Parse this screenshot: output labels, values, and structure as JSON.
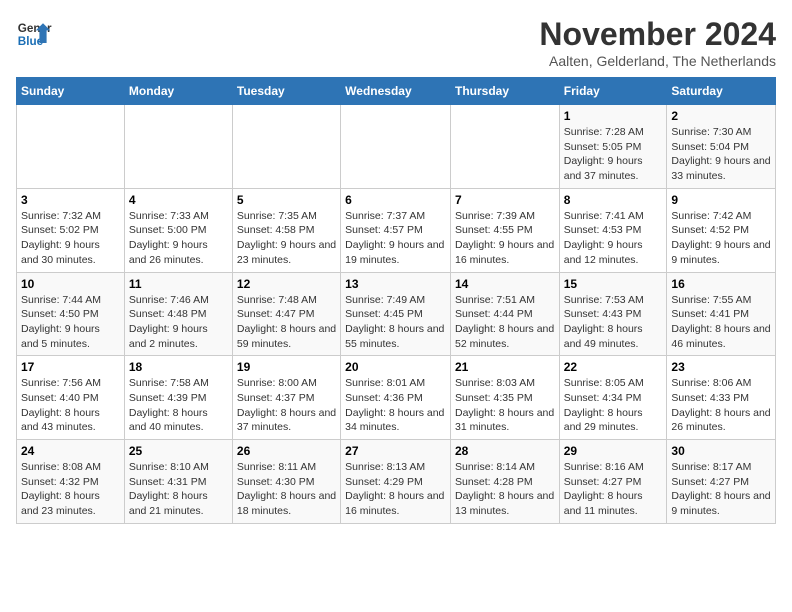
{
  "logo": {
    "line1": "General",
    "line2": "Blue"
  },
  "title": "November 2024",
  "subtitle": "Aalten, Gelderland, The Netherlands",
  "weekdays": [
    "Sunday",
    "Monday",
    "Tuesday",
    "Wednesday",
    "Thursday",
    "Friday",
    "Saturday"
  ],
  "weeks": [
    [
      {
        "day": "",
        "info": ""
      },
      {
        "day": "",
        "info": ""
      },
      {
        "day": "",
        "info": ""
      },
      {
        "day": "",
        "info": ""
      },
      {
        "day": "",
        "info": ""
      },
      {
        "day": "1",
        "info": "Sunrise: 7:28 AM\nSunset: 5:05 PM\nDaylight: 9 hours and 37 minutes."
      },
      {
        "day": "2",
        "info": "Sunrise: 7:30 AM\nSunset: 5:04 PM\nDaylight: 9 hours and 33 minutes."
      }
    ],
    [
      {
        "day": "3",
        "info": "Sunrise: 7:32 AM\nSunset: 5:02 PM\nDaylight: 9 hours and 30 minutes."
      },
      {
        "day": "4",
        "info": "Sunrise: 7:33 AM\nSunset: 5:00 PM\nDaylight: 9 hours and 26 minutes."
      },
      {
        "day": "5",
        "info": "Sunrise: 7:35 AM\nSunset: 4:58 PM\nDaylight: 9 hours and 23 minutes."
      },
      {
        "day": "6",
        "info": "Sunrise: 7:37 AM\nSunset: 4:57 PM\nDaylight: 9 hours and 19 minutes."
      },
      {
        "day": "7",
        "info": "Sunrise: 7:39 AM\nSunset: 4:55 PM\nDaylight: 9 hours and 16 minutes."
      },
      {
        "day": "8",
        "info": "Sunrise: 7:41 AM\nSunset: 4:53 PM\nDaylight: 9 hours and 12 minutes."
      },
      {
        "day": "9",
        "info": "Sunrise: 7:42 AM\nSunset: 4:52 PM\nDaylight: 9 hours and 9 minutes."
      }
    ],
    [
      {
        "day": "10",
        "info": "Sunrise: 7:44 AM\nSunset: 4:50 PM\nDaylight: 9 hours and 5 minutes."
      },
      {
        "day": "11",
        "info": "Sunrise: 7:46 AM\nSunset: 4:48 PM\nDaylight: 9 hours and 2 minutes."
      },
      {
        "day": "12",
        "info": "Sunrise: 7:48 AM\nSunset: 4:47 PM\nDaylight: 8 hours and 59 minutes."
      },
      {
        "day": "13",
        "info": "Sunrise: 7:49 AM\nSunset: 4:45 PM\nDaylight: 8 hours and 55 minutes."
      },
      {
        "day": "14",
        "info": "Sunrise: 7:51 AM\nSunset: 4:44 PM\nDaylight: 8 hours and 52 minutes."
      },
      {
        "day": "15",
        "info": "Sunrise: 7:53 AM\nSunset: 4:43 PM\nDaylight: 8 hours and 49 minutes."
      },
      {
        "day": "16",
        "info": "Sunrise: 7:55 AM\nSunset: 4:41 PM\nDaylight: 8 hours and 46 minutes."
      }
    ],
    [
      {
        "day": "17",
        "info": "Sunrise: 7:56 AM\nSunset: 4:40 PM\nDaylight: 8 hours and 43 minutes."
      },
      {
        "day": "18",
        "info": "Sunrise: 7:58 AM\nSunset: 4:39 PM\nDaylight: 8 hours and 40 minutes."
      },
      {
        "day": "19",
        "info": "Sunrise: 8:00 AM\nSunset: 4:37 PM\nDaylight: 8 hours and 37 minutes."
      },
      {
        "day": "20",
        "info": "Sunrise: 8:01 AM\nSunset: 4:36 PM\nDaylight: 8 hours and 34 minutes."
      },
      {
        "day": "21",
        "info": "Sunrise: 8:03 AM\nSunset: 4:35 PM\nDaylight: 8 hours and 31 minutes."
      },
      {
        "day": "22",
        "info": "Sunrise: 8:05 AM\nSunset: 4:34 PM\nDaylight: 8 hours and 29 minutes."
      },
      {
        "day": "23",
        "info": "Sunrise: 8:06 AM\nSunset: 4:33 PM\nDaylight: 8 hours and 26 minutes."
      }
    ],
    [
      {
        "day": "24",
        "info": "Sunrise: 8:08 AM\nSunset: 4:32 PM\nDaylight: 8 hours and 23 minutes."
      },
      {
        "day": "25",
        "info": "Sunrise: 8:10 AM\nSunset: 4:31 PM\nDaylight: 8 hours and 21 minutes."
      },
      {
        "day": "26",
        "info": "Sunrise: 8:11 AM\nSunset: 4:30 PM\nDaylight: 8 hours and 18 minutes."
      },
      {
        "day": "27",
        "info": "Sunrise: 8:13 AM\nSunset: 4:29 PM\nDaylight: 8 hours and 16 minutes."
      },
      {
        "day": "28",
        "info": "Sunrise: 8:14 AM\nSunset: 4:28 PM\nDaylight: 8 hours and 13 minutes."
      },
      {
        "day": "29",
        "info": "Sunrise: 8:16 AM\nSunset: 4:27 PM\nDaylight: 8 hours and 11 minutes."
      },
      {
        "day": "30",
        "info": "Sunrise: 8:17 AM\nSunset: 4:27 PM\nDaylight: 8 hours and 9 minutes."
      }
    ]
  ]
}
